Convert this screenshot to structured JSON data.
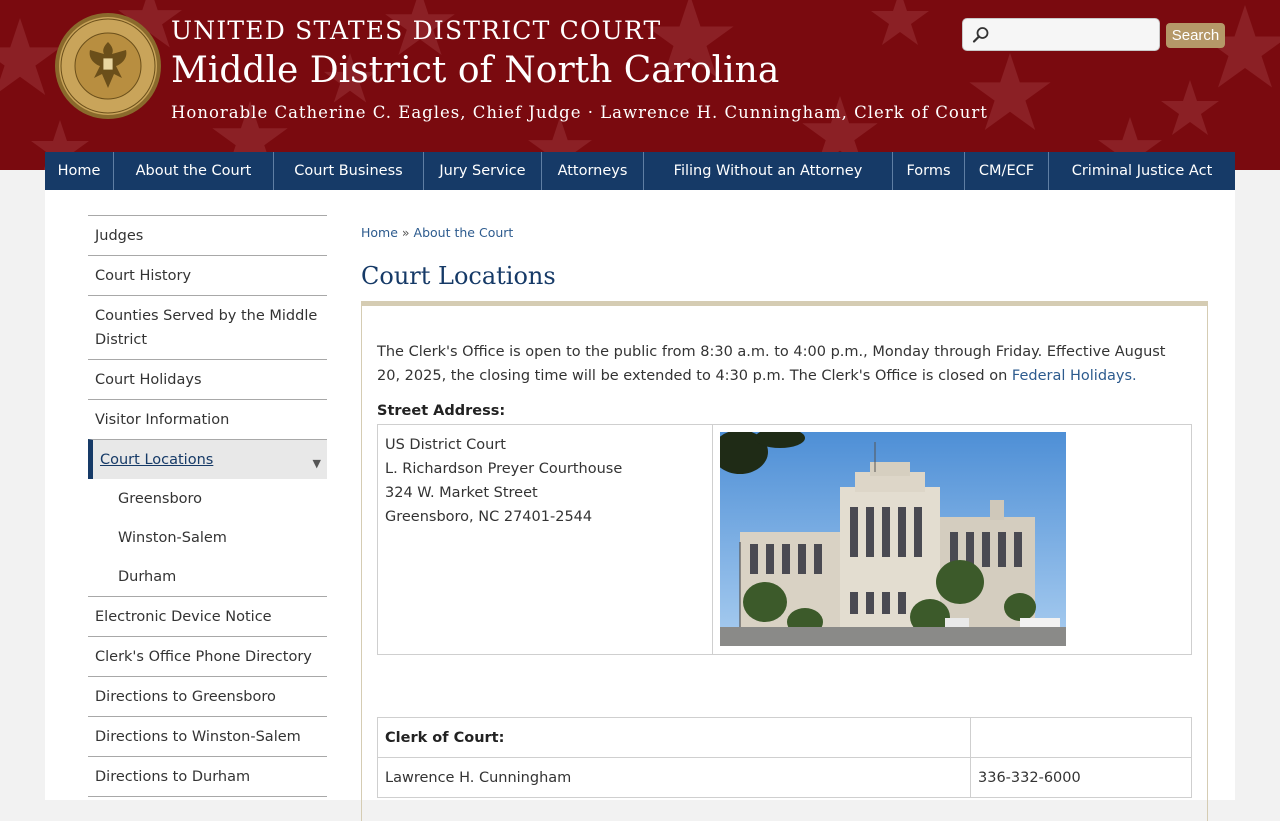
{
  "header": {
    "line1": "UNITED STATES DISTRICT COURT",
    "line2": "Middle District of North Carolina",
    "line3": "Honorable Catherine C. Eagles, Chief Judge · Lawrence H. Cunningham, Clerk of Court",
    "seal_icon": "court-seal-icon"
  },
  "search": {
    "placeholder": "",
    "button_label": "Search"
  },
  "nav": {
    "items": [
      {
        "label": "Home"
      },
      {
        "label": "About the Court"
      },
      {
        "label": "Court Business"
      },
      {
        "label": "Jury Service"
      },
      {
        "label": "Attorneys"
      },
      {
        "label": "Filing Without an Attorney"
      },
      {
        "label": "Forms"
      },
      {
        "label": "CM/ECF"
      },
      {
        "label": "Criminal Justice Act"
      }
    ]
  },
  "sidebar": {
    "items": [
      {
        "label": "Judges"
      },
      {
        "label": "Court History"
      },
      {
        "label": "Counties Served by the Middle District"
      },
      {
        "label": "Court Holidays"
      },
      {
        "label": "Visitor Information"
      },
      {
        "label": "Court Locations",
        "active": true
      },
      {
        "label": "Greensboro"
      },
      {
        "label": "Winston-Salem"
      },
      {
        "label": "Durham"
      },
      {
        "label": "Electronic Device Notice"
      },
      {
        "label": "Clerk's Office Phone Directory"
      },
      {
        "label": "Directions to Greensboro"
      },
      {
        "label": "Directions to Winston-Salem"
      },
      {
        "label": "Directions to Durham"
      }
    ],
    "caret": "▼"
  },
  "breadcrumb": {
    "home": "Home",
    "separator": "»",
    "current": "About the Court"
  },
  "page": {
    "title": "Court Locations",
    "intro_text": "The Clerk's Office is open to the public from 8:30 a.m. to 4:00 p.m., Monday through Friday.  Effective August 20, 2025, the closing time will be extended to 4:30 p.m. The Clerk's Office is closed on ",
    "intro_link": "Federal Holidays.",
    "street_label": "Street Address:",
    "address": {
      "line1": "US District Court",
      "line2": "L. Richardson Preyer Courthouse",
      "line3": "324 W. Market Street",
      "line4": "Greensboro, NC 27401-2544"
    },
    "clerk_table": {
      "header": "Clerk of Court:",
      "name": "Lawrence H. Cunningham",
      "phone": "336-332-6000"
    }
  },
  "colors": {
    "header_red": "#7a0a0f",
    "nav_blue": "#163a67",
    "link_blue": "#2d5b8e",
    "search_gold": "#b59868",
    "rule_tan": "#d5ccb3"
  }
}
